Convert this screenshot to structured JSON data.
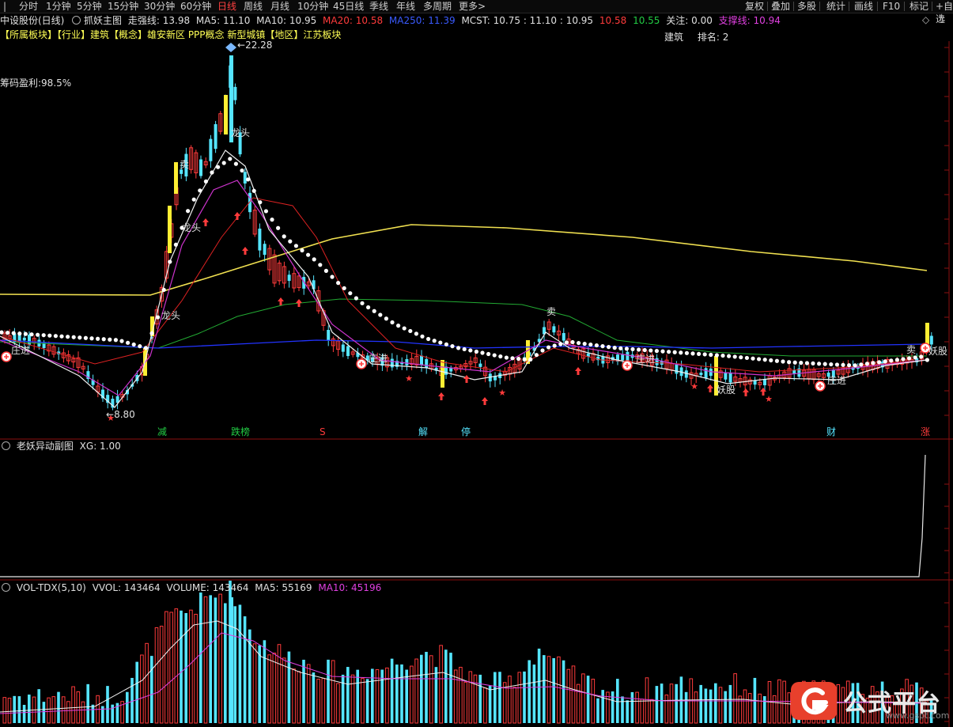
{
  "toolbar": {
    "tabs": [
      "分时",
      "1分钟",
      "5分钟",
      "15分钟",
      "30分钟",
      "60分钟",
      "日线",
      "周线",
      "月线",
      "10分钟",
      "45日线",
      "季线",
      "年线",
      "多周期",
      "更多>"
    ],
    "active_tab": "日线",
    "right_buttons": [
      "复权",
      "叠加",
      "多股",
      "统计",
      "画线",
      "F10",
      "标记",
      "+自选"
    ]
  },
  "header": {
    "stock": "中设股份(日线)",
    "indicator": "抓妖主图",
    "items": [
      {
        "text": "走强线: 13.98",
        "color": "#e0e0e0"
      },
      {
        "text": "MA5: 11.10",
        "color": "#e0e0e0"
      },
      {
        "text": "MA10: 10.95",
        "color": "#e0e0e0"
      },
      {
        "text": "MA20: 10.58",
        "color": "#ff3b3b"
      },
      {
        "text": "MA250: 11.39",
        "color": "#3a5bff"
      },
      {
        "text": "MCST: 10.75 : 11.10 : 10.95",
        "color": "#e0e0e0"
      },
      {
        "text": "10.58",
        "color": "#ff3b3b"
      },
      {
        "text": "10.55",
        "color": "#22cc44"
      },
      {
        "text": "关注: 0.00",
        "color": "#e0e0e0"
      },
      {
        "text": "支撑线: 10.94",
        "color": "#e040e0"
      }
    ]
  },
  "sector_line": "【所属板块】【行业】建筑【概念】雄安新区 PPP概念 新型城镇【地区】江苏板块",
  "rank": {
    "sector": "建筑",
    "label": "排名: 2"
  },
  "chip_profit": "筹码盈利:98.5%",
  "annotations": {
    "peak": "22.28",
    "low": "8.80",
    "sell1": "卖",
    "sell2": "卖",
    "sell3": "卖",
    "dragon1": "龙头",
    "dragon2": "龙头",
    "dragon3": "龙头",
    "enter1": "庄进",
    "enter2": "庄进",
    "enter3": "庄进",
    "enter4": "庄进",
    "yao1": "妖股",
    "yao2": "妖股"
  },
  "event_tags": [
    {
      "text": "减",
      "color": "#22cc44"
    },
    {
      "text": "跌榜",
      "color": "#22cc44"
    },
    {
      "text": "S",
      "color": "#ff3b3b"
    },
    {
      "text": "解",
      "color": "#55e5ff"
    },
    {
      "text": "停",
      "color": "#55e5ff"
    },
    {
      "text": "财",
      "color": "#55e5ff"
    },
    {
      "text": "涨",
      "color": "#ff3b3b"
    }
  ],
  "sub_panel": {
    "title": "老妖异动副图",
    "xg": "XG: 1.00"
  },
  "vol_panel": {
    "title": "VOL-TDX(5,10)",
    "vvol": "VVOL: 143464",
    "volume": "VOLUME: 143464",
    "ma5": "MA5: 55169",
    "ma10": "MA10: 45196"
  },
  "watermark": {
    "brand": "公式平台",
    "url": "www.gspt.com"
  },
  "colors": {
    "up": "#ff3b3b",
    "down": "#55e5ff",
    "ma250": "#f0e050",
    "ma60": "#22aa33",
    "ma120": "#2233ff"
  }
}
